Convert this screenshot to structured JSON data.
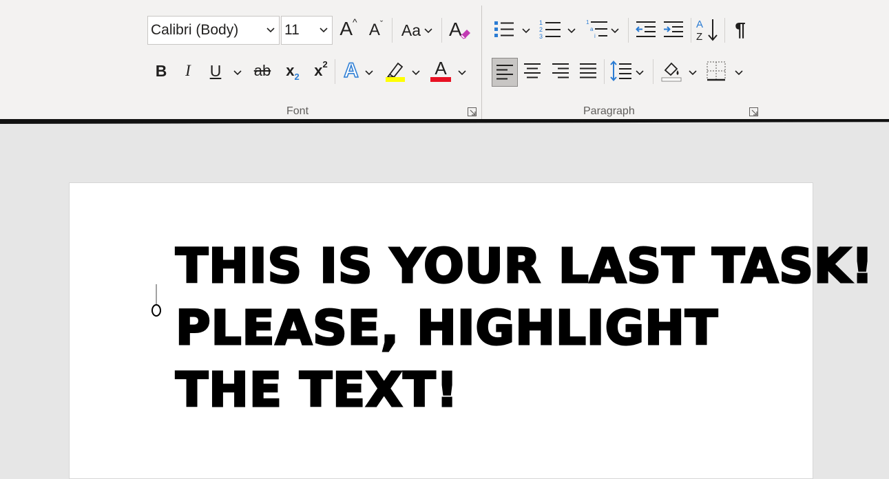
{
  "ribbon": {
    "font_group": {
      "label": "Font",
      "font_name": "Calibri (Body)",
      "font_size": "11",
      "grow_font": "A",
      "shrink_font": "A",
      "change_case": "Aa",
      "bold": "B",
      "italic": "I",
      "underline": "U",
      "strikethrough": "ab",
      "subscript": "x",
      "superscript": "x",
      "text_effects": "A",
      "font_color": "A",
      "highlight_color": "#ffff00",
      "font_color_value": "#e81123"
    },
    "paragraph_group": {
      "label": "Paragraph",
      "pilcrow": "¶"
    }
  },
  "document": {
    "lines": [
      "THIS IS YOUR LAST TASK!",
      "PLEASE, HIGHLIGHT",
      "THE TEXT!"
    ]
  }
}
